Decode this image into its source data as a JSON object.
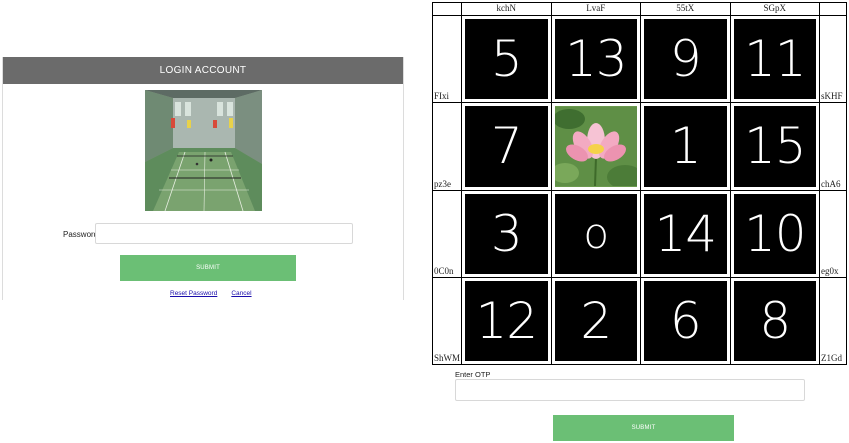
{
  "login": {
    "header": "LOGIN ACCOUNT",
    "image_icon": "sports-hall-photo",
    "password_label": "Password",
    "password_value": "",
    "submit_label": "SUBMIT",
    "reset_link": "Reset Password",
    "cancel_link": "Cancel"
  },
  "captcha": {
    "columns": [
      "kchN",
      "LvaF",
      "55tX",
      "SGpX"
    ],
    "rows": [
      {
        "left": "FIxi",
        "right": "sKHF",
        "cells": [
          "5",
          "13",
          "9",
          "11"
        ]
      },
      {
        "left": "pz3e",
        "right": "chA6",
        "cells": [
          "7",
          "",
          "1",
          "15"
        ]
      },
      {
        "left": "0C0n",
        "right": "eg0x",
        "cells": [
          "3",
          "o",
          "14",
          "10"
        ]
      },
      {
        "left": "ShWM",
        "right": "Z1Gd",
        "cells": [
          "12",
          "2",
          "6",
          "8"
        ]
      }
    ],
    "image_cell_icon": "lotus-flower-image"
  },
  "otp": {
    "label": "Enter OTP",
    "value": "",
    "submit_label": "SUBMIT"
  },
  "colors": {
    "header_bg": "#6b6b6b",
    "button_green": "#6bbf75",
    "link_blue": "#1a0dab",
    "tile_bg": "#000000"
  }
}
